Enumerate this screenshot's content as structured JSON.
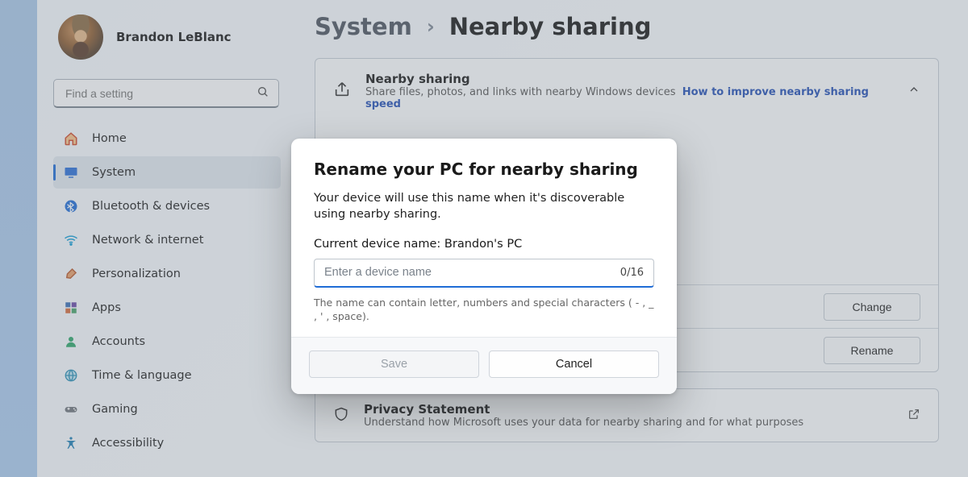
{
  "user": {
    "name": "Brandon LeBlanc"
  },
  "search": {
    "placeholder": "Find a setting"
  },
  "nav": [
    {
      "label": "Home",
      "icon": "home-icon"
    },
    {
      "label": "System",
      "icon": "system-icon",
      "active": true
    },
    {
      "label": "Bluetooth & devices",
      "icon": "bluetooth-icon"
    },
    {
      "label": "Network & internet",
      "icon": "wifi-icon"
    },
    {
      "label": "Personalization",
      "icon": "brush-icon"
    },
    {
      "label": "Apps",
      "icon": "apps-icon"
    },
    {
      "label": "Accounts",
      "icon": "person-icon"
    },
    {
      "label": "Time & language",
      "icon": "globe-icon"
    },
    {
      "label": "Gaming",
      "icon": "gamepad-icon"
    },
    {
      "label": "Accessibility",
      "icon": "accessibility-icon"
    }
  ],
  "crumbs": {
    "parent": "System",
    "current": "Nearby sharing"
  },
  "hero": {
    "title": "Nearby sharing",
    "desc": "Share files, photos, and links with nearby Windows devices",
    "link": "How to improve nearby sharing speed"
  },
  "rows": {
    "change": "Change",
    "rename": "Rename"
  },
  "privacy": {
    "title": "Privacy Statement",
    "desc": "Understand how Microsoft uses your data for nearby sharing and for what purposes"
  },
  "dialog": {
    "title": "Rename your PC for nearby sharing",
    "sub": "Your device will use this name when it's discoverable using nearby sharing.",
    "current_label": "Current device name: ",
    "current_value": "Brandon's PC",
    "placeholder": "Enter a device name",
    "counter": "0/16",
    "hint": "The name can contain letter, numbers and special characters ( - , _ , ' , space).",
    "save": "Save",
    "cancel": "Cancel"
  }
}
